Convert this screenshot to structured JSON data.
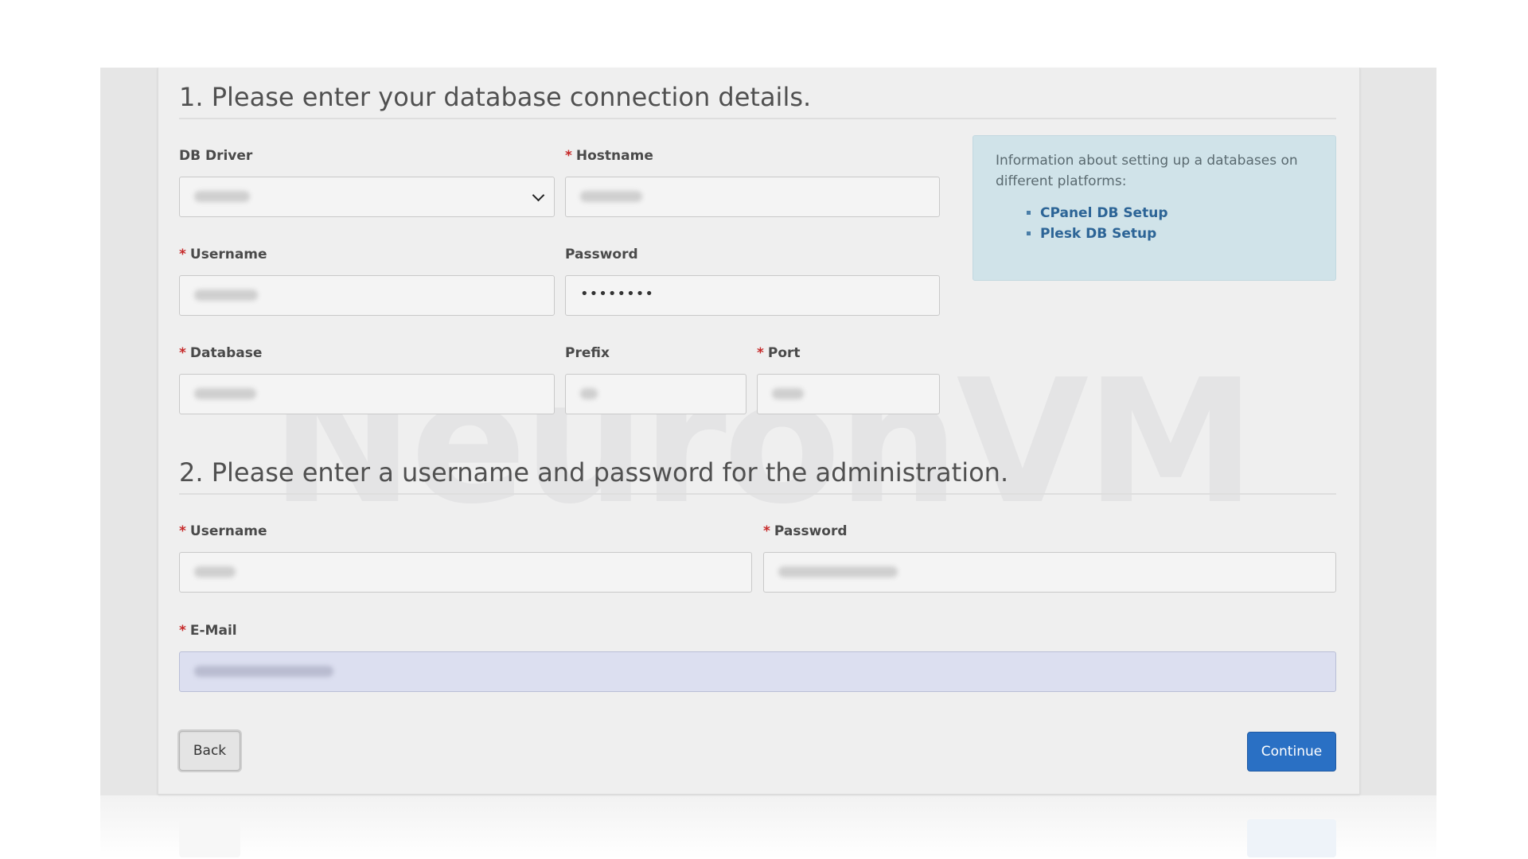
{
  "section1": {
    "title": "1. Please enter your database connection details.",
    "db_driver": {
      "label": "DB Driver",
      "required": false
    },
    "hostname": {
      "label": "Hostname",
      "required": true
    },
    "db_username": {
      "label": "Username",
      "required": true
    },
    "db_password": {
      "label": "Password",
      "required": false,
      "value": "••••••••"
    },
    "database": {
      "label": "Database",
      "required": true
    },
    "prefix": {
      "label": "Prefix",
      "required": false
    },
    "port": {
      "label": "Port",
      "required": true
    }
  },
  "info_box": {
    "text": "Information about setting up a databases on different platforms:",
    "links": [
      {
        "label": "CPanel DB Setup"
      },
      {
        "label": "Plesk DB Setup"
      }
    ]
  },
  "section2": {
    "title": "2. Please enter a username and password for the administration.",
    "admin_username": {
      "label": "Username",
      "required": true
    },
    "admin_password": {
      "label": "Password",
      "required": true
    },
    "email": {
      "label": "E-Mail",
      "required": true
    }
  },
  "buttons": {
    "back": "Back",
    "continue": "Continue"
  },
  "watermark": "NeuronVM",
  "required_marker": "*"
}
